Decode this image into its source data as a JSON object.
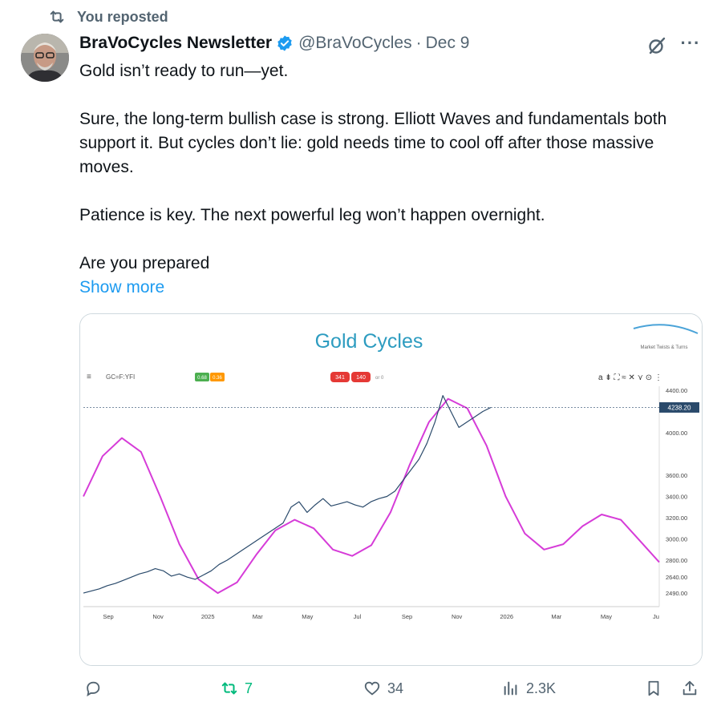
{
  "repost": {
    "label": "You reposted"
  },
  "author": {
    "name": "BraVoCycles Newsletter",
    "handle": "@BraVoCycles",
    "separator": "·",
    "date": "Dec 9"
  },
  "tweet": {
    "paragraphs": [
      "Gold isn’t ready to run—yet.",
      "Sure, the long-term bullish case is strong. Elliott Waves and fundamentals both support it. But cycles don’t lie: gold needs time to cool off after those massive moves.",
      "Patience is key. The next powerful leg won’t happen overnight.",
      "Are you prepared"
    ],
    "show_more": "Show more"
  },
  "chart_image": {
    "title": "Gold Cycles",
    "logo_text": "Market Twists & Turns",
    "symbol": "GC=F:YFI",
    "badges": [
      "0.68",
      "0.36",
      "341",
      "140"
    ],
    "badge_suffix": "or 0",
    "last_price_label": "4238.20"
  },
  "chart_data": {
    "type": "line",
    "title": "Gold Cycles",
    "x_tick_labels": [
      "Sep",
      "Nov",
      "2025",
      "Mar",
      "May",
      "Jul",
      "Sep",
      "Nov",
      "2026",
      "Mar",
      "May",
      "Ju"
    ],
    "y_tick_labels": [
      "4400.00",
      "4000.00",
      "3600.00",
      "3400.00",
      "3200.00",
      "3000.00",
      "2800.00",
      "2640.00",
      "2490.00"
    ],
    "ylim": [
      2400,
      4400
    ],
    "series": [
      {
        "kind": "price",
        "color": "#2a4a6b",
        "values": [
          2490,
          2510,
          2530,
          2560,
          2580,
          2610,
          2640,
          2670,
          2690,
          2720,
          2700,
          2650,
          2670,
          2640,
          2620,
          2660,
          2700,
          2760,
          2800,
          2850,
          2900,
          2950,
          3000,
          3050,
          3100,
          3150,
          3300,
          3350,
          3250,
          3320,
          3380,
          3310,
          3330,
          3350,
          3320,
          3300,
          3350,
          3380,
          3400,
          3450,
          3550,
          3650,
          3750,
          3900,
          4100,
          4350,
          4200,
          4050,
          4100,
          4150,
          4200,
          4238
        ]
      },
      {
        "kind": "cycle",
        "color": "#d63cd8",
        "values": [
          3400,
          3780,
          3950,
          3820,
          3400,
          2950,
          2620,
          2490,
          2590,
          2850,
          3080,
          3180,
          3100,
          2900,
          2840,
          2940,
          3250,
          3700,
          4100,
          4320,
          4230,
          3880,
          3400,
          3050,
          2900,
          2950,
          3120,
          3230,
          3180,
          2980,
          2780
        ]
      }
    ],
    "colors": {
      "title": "#2d9cc0",
      "cycle": "#d63cd8",
      "price": "#2a4a6b"
    }
  },
  "actions": {
    "reply": "",
    "repost": "7",
    "like": "34",
    "views": "2.3K"
  },
  "colors": {
    "accent": "#1d9bf0",
    "muted": "#536471",
    "repost_active": "#00ba7c"
  }
}
